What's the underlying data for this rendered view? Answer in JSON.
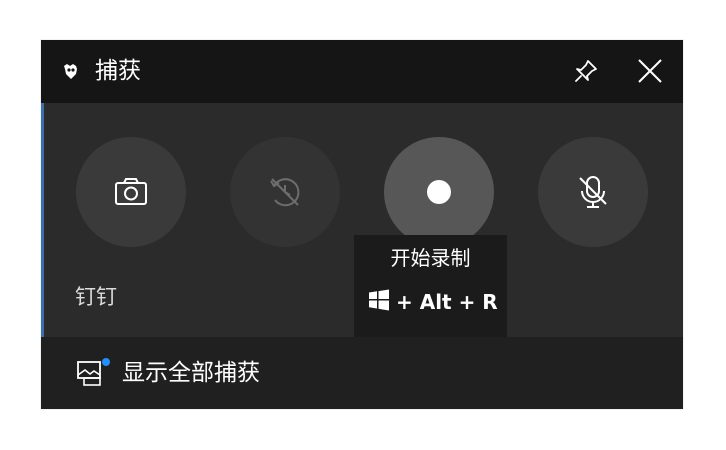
{
  "window": {
    "title": "捕获",
    "title_icon": "capture-widget-icon",
    "pin_icon": "pin-icon",
    "close_icon": "close-icon"
  },
  "buttons": [
    {
      "icon": "camera-icon",
      "state": "enabled"
    },
    {
      "icon": "record-last-disabled-icon",
      "state": "disabled"
    },
    {
      "icon": "record-dot-icon",
      "state": "hovered"
    },
    {
      "icon": "microphone-muted-icon",
      "state": "enabled"
    }
  ],
  "tooltip": {
    "title": "开始录制",
    "shortcut": "+ Alt + R",
    "shortcut_icon": "windows-logo-icon"
  },
  "app_name": "钉钉",
  "footer": {
    "label": "显示全部捕获",
    "icon": "gallery-icon",
    "badge_color": "#1e90ff"
  },
  "colors": {
    "panel": "#2b2b2b",
    "titlebar": "#151515",
    "footer": "#202020",
    "accent_edge": "#3a6fb0"
  }
}
